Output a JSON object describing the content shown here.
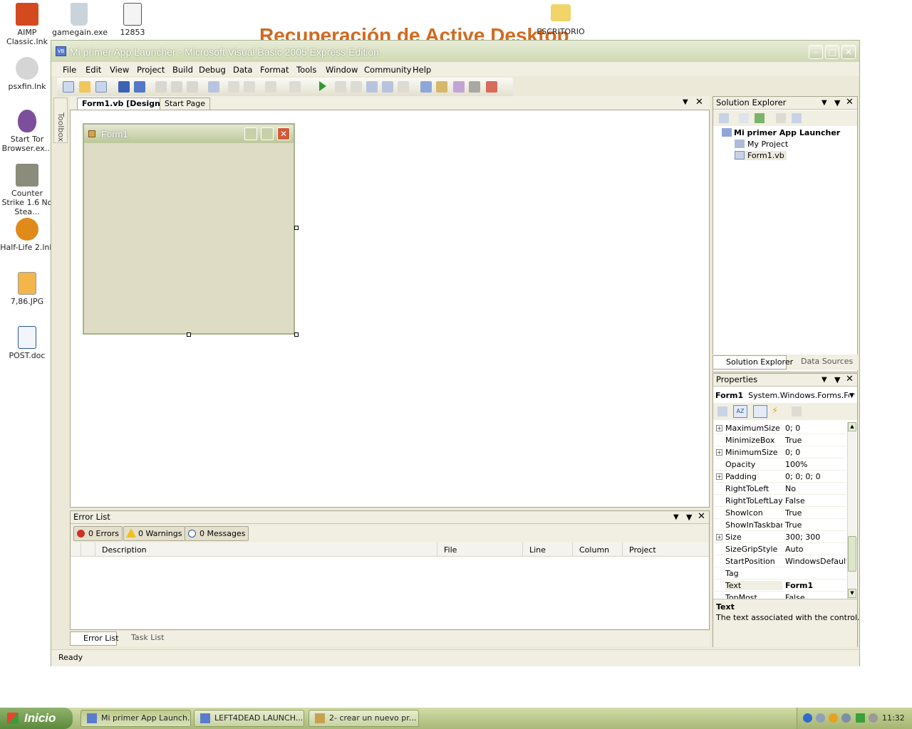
{
  "desktop": {
    "background_text": "Recuperación de Active Desktop",
    "icons": [
      {
        "label": "AIMP Classic.lnk"
      },
      {
        "label": "gamegain.exe"
      },
      {
        "label": "12853"
      },
      {
        "label": "ESCRITORIO"
      },
      {
        "label": "psxfin.lnk"
      },
      {
        "label": "Start Tor Browser.ex..."
      },
      {
        "label": "Counter Strike 1.6 No Stea..."
      },
      {
        "label": "Half-Life 2.lnk"
      },
      {
        "label": "7,86.JPG"
      },
      {
        "label": "POST.doc"
      }
    ]
  },
  "window": {
    "title": "Mi primer App Launcher - Microsoft Visual Basic 2005 Express Edition",
    "app_icon_text": "VB"
  },
  "menu": [
    "File",
    "Edit",
    "View",
    "Project",
    "Build",
    "Debug",
    "Data",
    "Format",
    "Tools",
    "Window",
    "Community",
    "Help"
  ],
  "doc_tabs": {
    "active": "Form1.vb [Design]",
    "inactive": "Start Page"
  },
  "toolbox": {
    "label": "Toolbox"
  },
  "designer": {
    "form_title": "Form1"
  },
  "solution_explorer": {
    "title": "Solution Explorer",
    "root": "Mi primer App Launcher",
    "items": [
      "My Project",
      "Form1.vb"
    ],
    "footer_tabs": [
      "Solution Explorer",
      "Data Sources"
    ]
  },
  "properties": {
    "title": "Properties",
    "object": "Form1",
    "object_type": "System.Windows.Forms.Form",
    "rows": [
      {
        "name": "MaximumSize",
        "value": "0; 0",
        "expandable": true
      },
      {
        "name": "MinimizeBox",
        "value": "True",
        "expandable": false
      },
      {
        "name": "MinimumSize",
        "value": "0; 0",
        "expandable": true
      },
      {
        "name": "Opacity",
        "value": "100%",
        "expandable": false
      },
      {
        "name": "Padding",
        "value": "0; 0; 0; 0",
        "expandable": true
      },
      {
        "name": "RightToLeft",
        "value": "No",
        "expandable": false
      },
      {
        "name": "RightToLeftLayo",
        "value": "False",
        "expandable": false
      },
      {
        "name": "ShowIcon",
        "value": "True",
        "expandable": false
      },
      {
        "name": "ShowInTaskbar",
        "value": "True",
        "expandable": false
      },
      {
        "name": "Size",
        "value": "300; 300",
        "expandable": true
      },
      {
        "name": "SizeGripStyle",
        "value": "Auto",
        "expandable": false
      },
      {
        "name": "StartPosition",
        "value": "WindowsDefaultLo",
        "expandable": false
      },
      {
        "name": "Tag",
        "value": "",
        "expandable": false
      },
      {
        "name": "Text",
        "value": "Form1",
        "expandable": false
      },
      {
        "name": "TopMost",
        "value": "False",
        "expandable": false
      }
    ],
    "desc_title": "Text",
    "desc_text": "The text associated with the control."
  },
  "error_list": {
    "title": "Error List",
    "errors": "0 Errors",
    "warnings": "0 Warnings",
    "messages": "0 Messages",
    "columns": [
      "Description",
      "File",
      "Line",
      "Column",
      "Project"
    ],
    "footer_tabs": [
      "Error List",
      "Task List"
    ]
  },
  "status": "Ready",
  "taskbar": {
    "start": "Inicio",
    "buttons": [
      "Mi primer App Launch...",
      "LEFT4DEAD LAUNCH...",
      "2- crear un nuevo pr..."
    ],
    "clock": "11:32"
  }
}
